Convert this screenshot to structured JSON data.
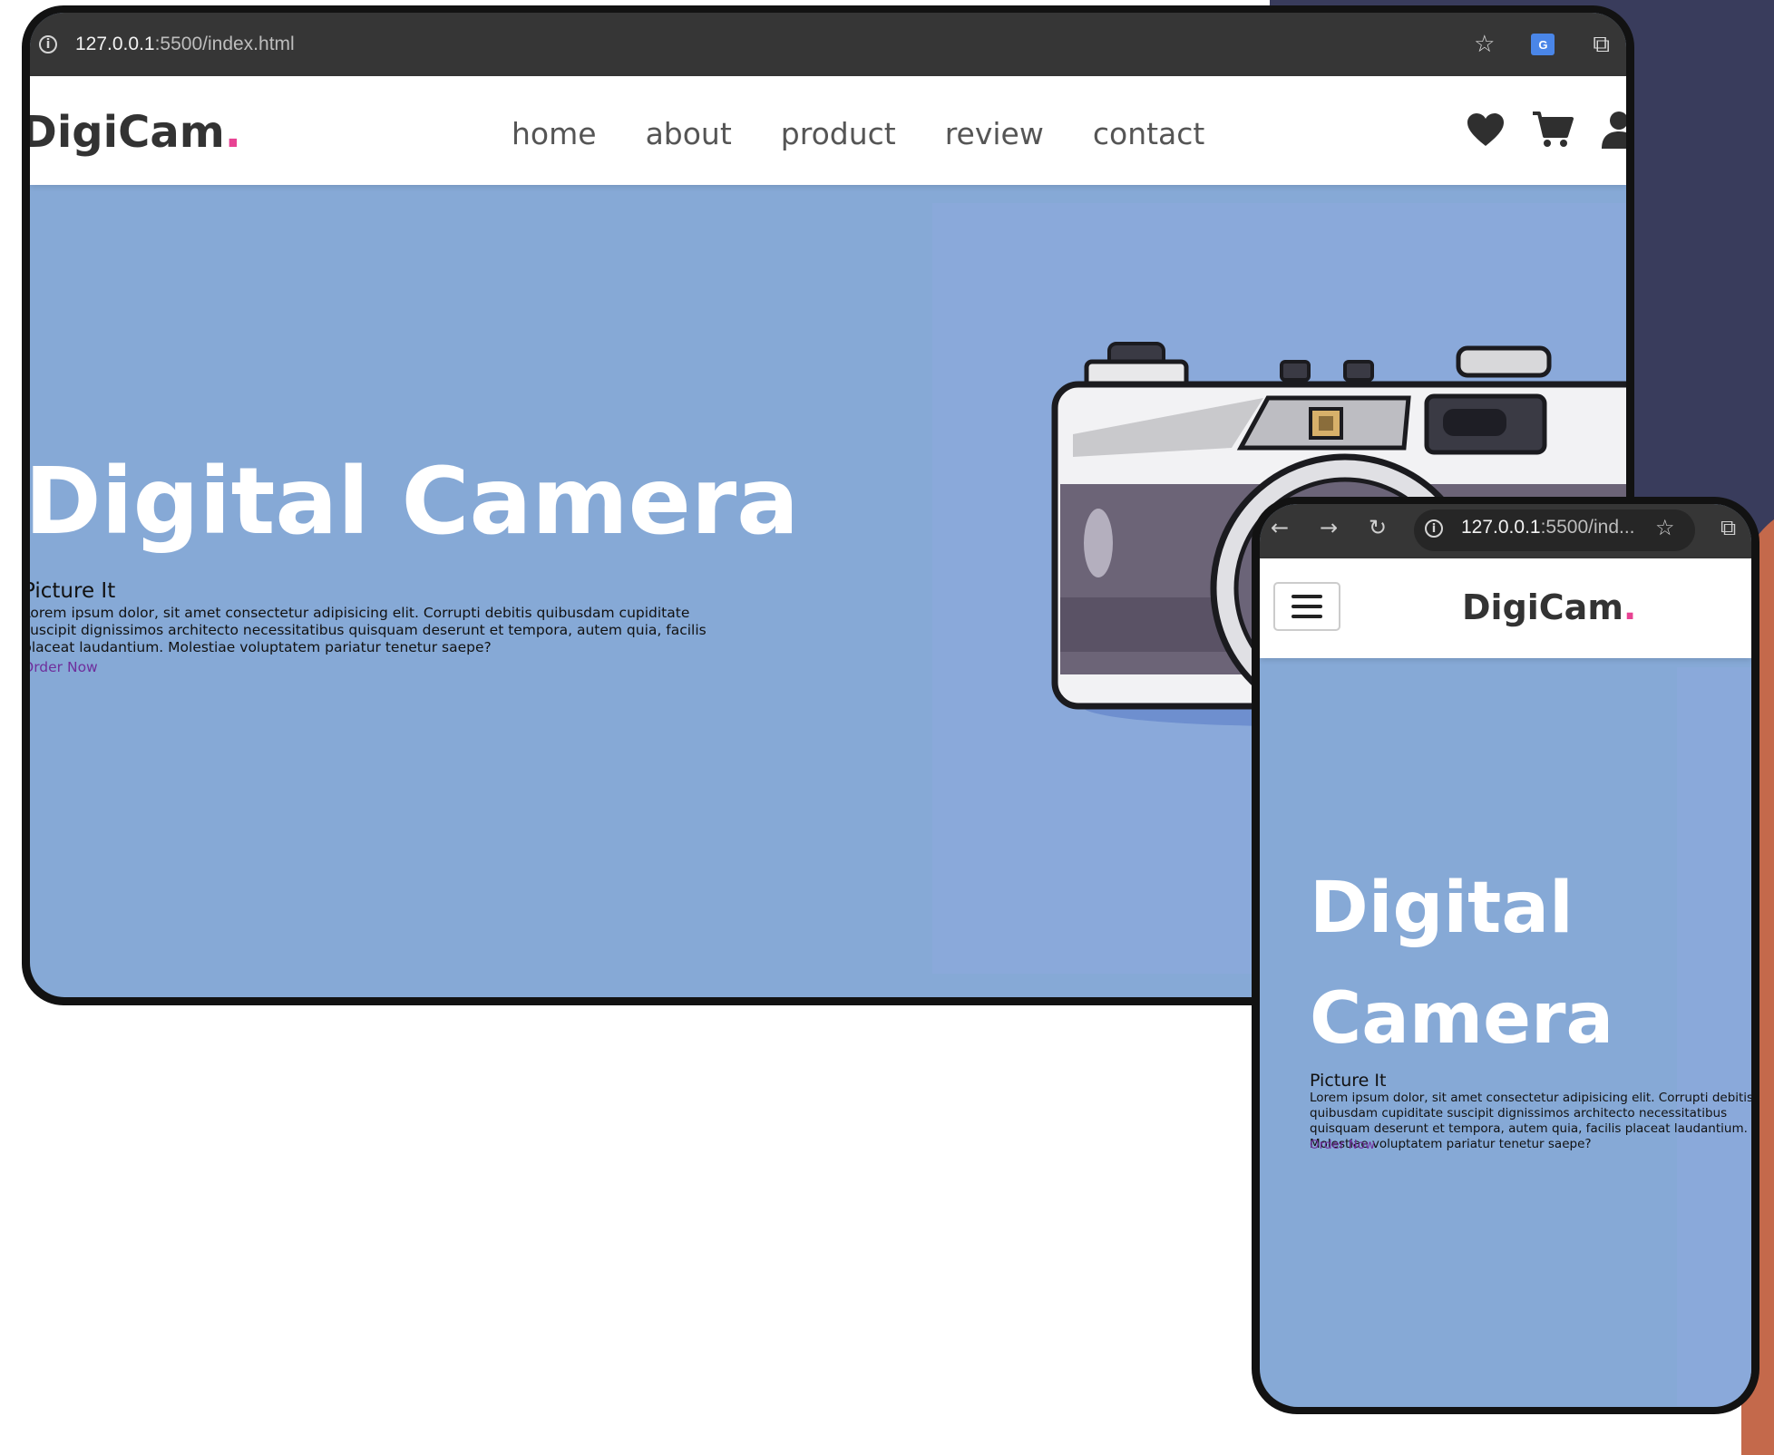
{
  "background": {
    "navy": "#393c5c",
    "orange": "#c4694b"
  },
  "desktop": {
    "address_bar": {
      "url_host": "127.0.0.1",
      "url_rest": ":5500/index.html"
    },
    "nav": {
      "logo_text": "DigiCam",
      "logo_dot": ".",
      "links": [
        "home",
        "about",
        "product",
        "review",
        "contact"
      ],
      "icons": [
        "heart-icon",
        "cart-icon",
        "user-icon"
      ]
    },
    "hero": {
      "title": "Digital Camera",
      "subtitle": "Picture It",
      "text": "Lorem ipsum dolor, sit amet consectetur adipisicing elit. Corrupti debitis quibusdam cupiditate suscipit dignissimos architecto necessitatibus quisquam deserunt et tempora, autem quia, facilis placeat laudantium. Molestiae voluptatem pariatur tenetur saepe?",
      "cta": "Order Now"
    }
  },
  "mobile": {
    "address_bar": {
      "url_host": "127.0.0.1",
      "url_rest": ":5500/ind..."
    },
    "nav": {
      "logo_text": "DigiCam",
      "logo_dot": "."
    },
    "hero": {
      "title": "Digital Camera",
      "subtitle": "Picture It",
      "text": "Lorem ipsum dolor, sit amet consectetur adipisicing elit. Corrupti debitis quibusdam cupiditate suscipit dignissimos architecto necessitatibus quisquam deserunt et tempora, autem quia, facilis placeat laudantium. Molestiae voluptatem pariatur tenetur saepe?",
      "cta": "Order Now"
    }
  },
  "colors": {
    "accent_dot": "#e84393",
    "hero_bg": "#86a9d6",
    "link_purple": "#6f2f9c"
  }
}
